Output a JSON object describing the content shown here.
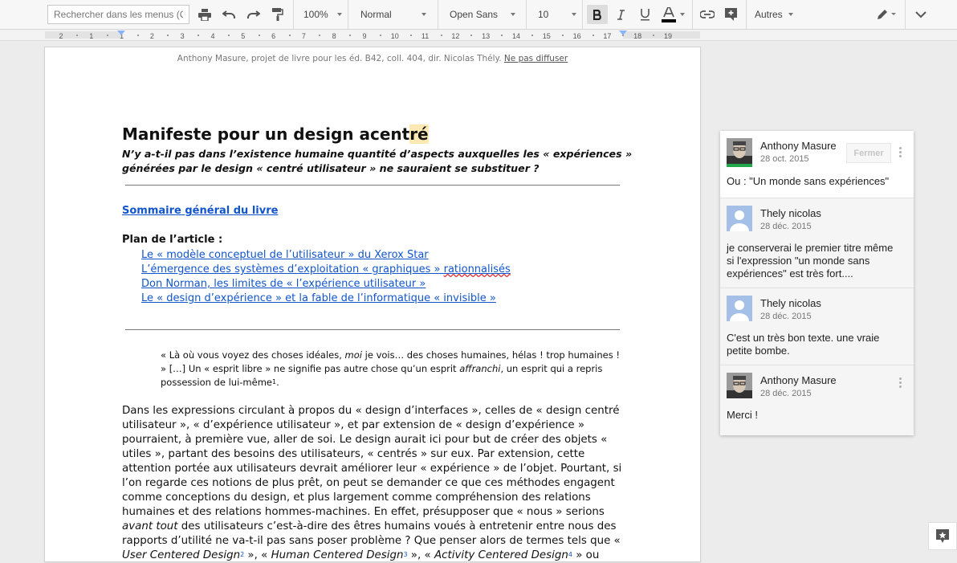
{
  "toolbar": {
    "search_placeholder": "Rechercher dans les menus (C",
    "zoom": "100%",
    "style": "Normal",
    "font": "Open Sans",
    "size": "10",
    "more": "Autres"
  },
  "ruler": {
    "labels": [
      "2",
      "1",
      "1",
      "2",
      "3",
      "4",
      "5",
      "6",
      "7",
      "8",
      "9",
      "10",
      "11",
      "12",
      "13",
      "14",
      "15",
      "16",
      "17",
      "18",
      "19"
    ]
  },
  "document": {
    "header": "Anthony Masure, projet de livre pour les éd. B42, coll. 404, dir. Nicolas Thély.",
    "header_link": "Ne pas diffuser",
    "title_a": "Manifeste pour un design acent",
    "title_b": "ré",
    "subtitle": "N’y a-t-il pas dans l’existence humaine quantité d’aspects auxquelles les « expériences » générées par le design « centré utilisateur » ne sauraient se substituer ?",
    "toc_link": "Sommaire général du livre",
    "plan_title": "Plan de l’article :",
    "toc": [
      "Le « modèle conceptuel de l’utilisateur » du Xerox Star",
      "L’émergence des systèmes d’exploitation « graphiques » ",
      "rationnalisés",
      "Don Norman, les limites de « l’expérience utilisateur »",
      "Le « design d’expérience » et la fable de l’informatique « invisible »"
    ],
    "quote_a": "« Là où vous voyez des choses idéales, ",
    "quote_moi": "moi",
    "quote_b": " je vois… des choses humaines, hélas ! trop humaines ! » […] Un « esprit libre » ne signifie pas autre chose qu’un esprit ",
    "quote_affranchi": "affranchi",
    "quote_c": ", un esprit qui a repris possession de lui-même",
    "quote_note": "1",
    "body_a": "Dans les expressions circulant à propos du « design d’interfaces », celles de « design centré utilisateur », « d’expérience utilisateur », et par extension de « design d’expérience » pourraient, à première vue, aller de soi. Le design aurait ici pour but de créer des objets « utiles », partant des besoins des utilisateurs, « centrés » sur eux. Par extension, cette attention portée aux utilisateurs devrait améliorer leur « expérience » de l’objet. Pourtant, si l’on regarde ces notions de plus prêt, on peut se demander ce que ces méthodes engagent comme conceptions du design, et plus largement comme compréhension des relations humaines et des relations hommes-machines. En effet, présupposer que « nous » serions ",
    "body_avant": "avant tout",
    "body_b": " des utilisateurs c’est-à-dire des êtres humains voués à entretenir entre nous des rapports d’utilité ne va-t-il pas sans poser problème ? Que penser alors de termes tels que « ",
    "body_ucd": "User Centered Design",
    "note2": "2",
    "body_c": " », « ",
    "body_hcd": "Human Centered Design",
    "note3": "3",
    "body_d": " », « ",
    "body_acd": "Activity Centered Design",
    "note4": "4",
    "body_e": " » ou"
  },
  "comments": {
    "close_label": "Fermer",
    "items": [
      {
        "name": "Anthony Masure",
        "date": "28 oct. 2015",
        "text": "Ou : \"Un monde sans expériences\""
      },
      {
        "name": "Thely nicolas",
        "date": "28 déc. 2015",
        "text": "je conserverai le premier titre même si l'expression \"un monde sans expériences\" est très fort...."
      },
      {
        "name": "Thely nicolas",
        "date": "28 déc. 2015",
        "text": "C'est un très bon texte. une vraie petite bombe."
      },
      {
        "name": "Anthony Masure",
        "date": "28 déc. 2015",
        "text": "Merci !"
      }
    ]
  },
  "colors": {
    "link": "#1155cc",
    "resolve_green": "#20a84a",
    "highlight": "#fce8b2"
  },
  "icons": [
    "print-icon",
    "undo-icon",
    "redo-icon",
    "paint-format-icon",
    "bold-icon",
    "italic-icon",
    "underline-icon",
    "text-color-icon",
    "link-icon",
    "add-comment-icon",
    "pencil-icon",
    "chevron-down-icon",
    "explore-icon"
  ]
}
